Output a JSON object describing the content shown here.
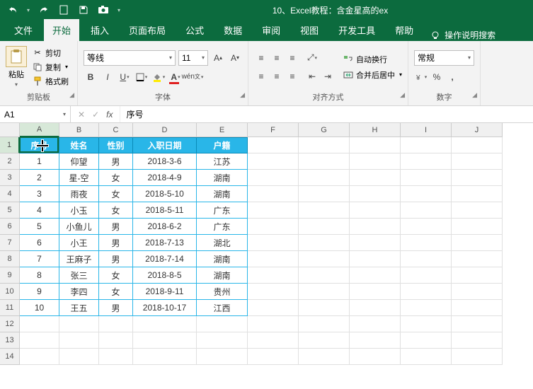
{
  "title": "10、Excel教程：含金星高的ex",
  "tabs": [
    "文件",
    "开始",
    "插入",
    "页面布局",
    "公式",
    "数据",
    "审阅",
    "视图",
    "开发工具",
    "帮助"
  ],
  "active_tab": 1,
  "tell_me": "操作说明搜索",
  "clipboard": {
    "cut": "剪切",
    "copy": "复制",
    "painter": "格式刷",
    "paste": "粘贴",
    "label": "剪贴板"
  },
  "font": {
    "family": "等线",
    "size": "11",
    "label": "字体"
  },
  "align": {
    "wrap": "自动换行",
    "merge": "合并后居中",
    "label": "对齐方式"
  },
  "number": {
    "format": "常规",
    "label": "数字"
  },
  "namebox": "A1",
  "formula": "序号",
  "cols": [
    "A",
    "B",
    "C",
    "D",
    "E",
    "F",
    "G",
    "H",
    "I",
    "J"
  ],
  "col_widths": [
    "col-A",
    "col-B",
    "col-C",
    "col-D",
    "col-E",
    "col-F",
    "col-G",
    "col-H",
    "col-I",
    "col-J"
  ],
  "headers": [
    "序号",
    "姓名",
    "性别",
    "入职日期",
    "户籍"
  ],
  "rows": [
    [
      "1",
      "仰望",
      "男",
      "2018-3-6",
      "江苏"
    ],
    [
      "2",
      "星-空",
      "女",
      "2018-4-9",
      "湖南"
    ],
    [
      "3",
      "雨夜",
      "女",
      "2018-5-10",
      "湖南"
    ],
    [
      "4",
      "小玉",
      "女",
      "2018-5-11",
      "广东"
    ],
    [
      "5",
      "小鱼儿",
      "男",
      "2018-6-2",
      "广东"
    ],
    [
      "6",
      "小王",
      "男",
      "2018-7-13",
      "湖北"
    ],
    [
      "7",
      "王麻子",
      "男",
      "2018-7-14",
      "湖南"
    ],
    [
      "8",
      "张三",
      "女",
      "2018-8-5",
      "湖南"
    ],
    [
      "9",
      "李四",
      "女",
      "2018-9-11",
      "贵州"
    ],
    [
      "10",
      "王五",
      "男",
      "2018-10-17",
      "江西"
    ]
  ],
  "empty_rows": 3
}
